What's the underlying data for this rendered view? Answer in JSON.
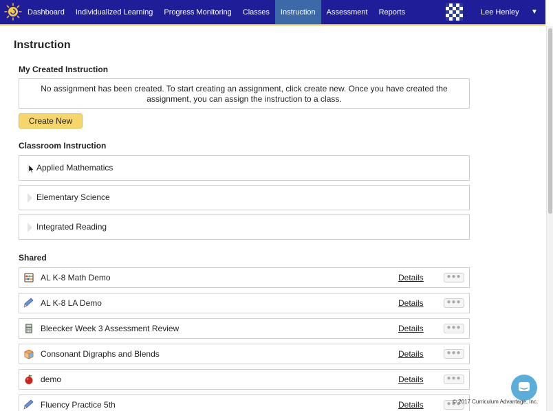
{
  "nav": {
    "items": [
      {
        "label": "Dashboard",
        "active": false
      },
      {
        "label": "Individualized Learning",
        "active": false
      },
      {
        "label": "Progress Monitoring",
        "active": false
      },
      {
        "label": "Classes",
        "active": false
      },
      {
        "label": "Instruction",
        "active": true
      },
      {
        "label": "Assessment",
        "active": false
      },
      {
        "label": "Reports",
        "active": false
      }
    ],
    "user_name": "Lee Henley",
    "caret": "▼",
    "bar_color": "#1f1e98",
    "active_color": "#3d69a9",
    "accent_color": "#e5b93c"
  },
  "page": {
    "title": "Instruction"
  },
  "my_created": {
    "heading": "My Created Instruction",
    "empty_message": "No assignment has been created. To start creating an assignment, click create new. Once you have created the assignment, you can assign the instruction to a class.",
    "create_label": "Create New"
  },
  "classroom": {
    "heading": "Classroom Instruction",
    "items": [
      {
        "label": "Applied Mathematics"
      },
      {
        "label": "Elementary Science"
      },
      {
        "label": "Integrated Reading"
      }
    ]
  },
  "shared": {
    "heading": "Shared",
    "details_label": "Details",
    "more_label": "●●●",
    "items": [
      {
        "label": "AL K-8 Math Demo",
        "icon": "abacus-icon"
      },
      {
        "label": "AL K-8 LA Demo",
        "icon": "pencil-icon"
      },
      {
        "label": "Bleecker Week 3 Assessment Review",
        "icon": "calculator-icon"
      },
      {
        "label": "Consonant Digraphs and Blends",
        "icon": "letter-blocks-icon"
      },
      {
        "label": "demo",
        "icon": "apple-icon"
      },
      {
        "label": "Fluency Practice 5th",
        "icon": "pencil-icon"
      }
    ]
  },
  "footer": {
    "copyright": "© 2017 Curriculum Advantage, Inc."
  }
}
